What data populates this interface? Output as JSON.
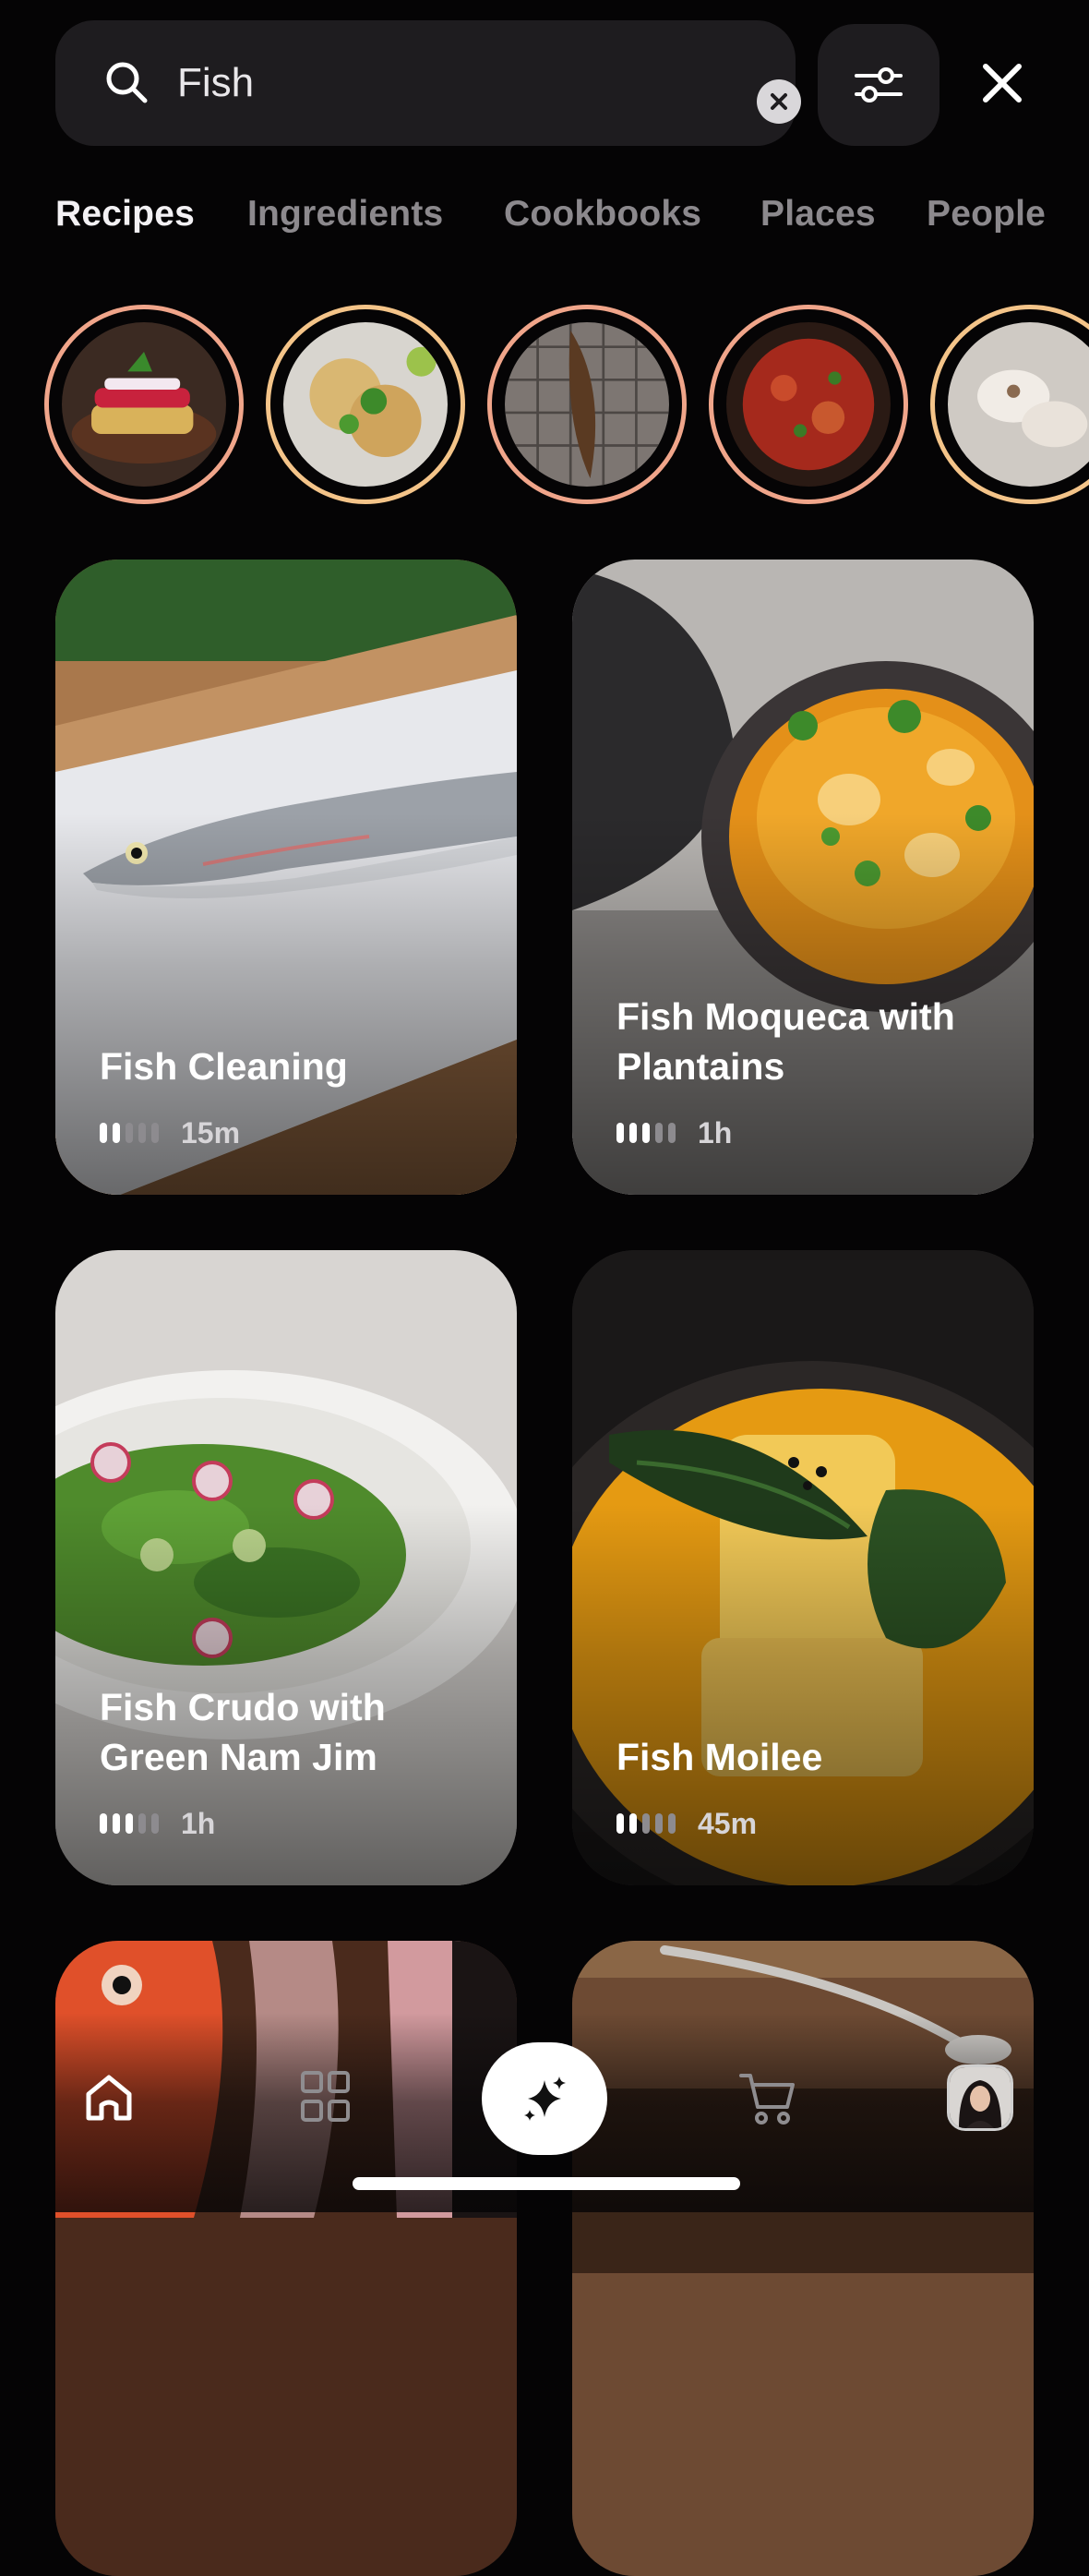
{
  "search": {
    "value": "Fish",
    "placeholder": "Search"
  },
  "tabs": [
    {
      "label": "Recipes",
      "active": true
    },
    {
      "label": "Ingredients",
      "active": false
    },
    {
      "label": "Cookbooks",
      "active": false
    },
    {
      "label": "Places",
      "active": false
    },
    {
      "label": "People",
      "active": false
    }
  ],
  "recipes": [
    {
      "title": "Fish Cleaning",
      "difficulty_level": 2,
      "difficulty_max": 5,
      "time": "15m"
    },
    {
      "title": "Fish Moqueca with Plantains",
      "difficulty_level": 3,
      "difficulty_max": 5,
      "time": "1h"
    },
    {
      "title": "Fish Crudo with Green Nam Jim",
      "difficulty_level": 3,
      "difficulty_max": 5,
      "time": "1h"
    },
    {
      "title": "Fish Moilee",
      "difficulty_level": 2,
      "difficulty_max": 5,
      "time": "45m"
    }
  ],
  "nav": {
    "items": [
      "home-icon",
      "grid-icon",
      "sparkles-icon",
      "cart-icon",
      "avatar"
    ]
  },
  "colors": {
    "background": "#050405",
    "story_ring_peach": "#f0a58a",
    "story_ring_gold": "#f4c489",
    "tab_active": "#f3f1f4",
    "tab_inactive": "#8c898d"
  }
}
